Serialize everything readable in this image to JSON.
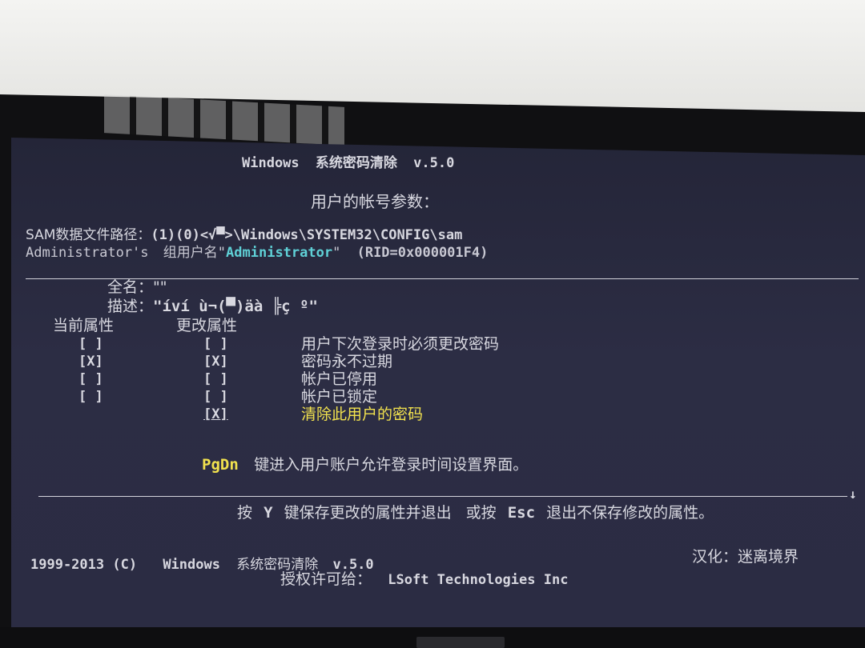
{
  "title_line": {
    "app": "Windows",
    "name": "系统密码清除",
    "version": "v.5.0"
  },
  "subtitle": "用户的帐号参数：",
  "sam_path": {
    "label": "SAM数据文件路径：",
    "value": "(1)(0)<√▀>\\Windows\\SYSTEM32\\CONFIG\\sam"
  },
  "account": {
    "prefix": "Administrator's",
    "group_label": "组用户名",
    "quote_open": "\"",
    "username": "Administrator",
    "quote_close": "\"",
    "rid": "(RID=0x000001F4)"
  },
  "fields": {
    "fullname_label": "全名：",
    "fullname_value": "\"\"",
    "desc_label": "描述：",
    "desc_value": "\"íví ù¬(▀)äà ╠ç º\""
  },
  "columns": {
    "current": "当前属性",
    "change": "更改属性"
  },
  "attributes": [
    {
      "current": "[ ]",
      "change": "[ ]",
      "label": "用户下次登录时必须更改密码",
      "highlight": false
    },
    {
      "current": "[X]",
      "change": "[X]",
      "label": "密码永不过期",
      "highlight": false
    },
    {
      "current": "[ ]",
      "change": "[ ]",
      "label": "帐户已停用",
      "highlight": false
    },
    {
      "current": "[ ]",
      "change": "[ ]",
      "label": "帐户已锁定",
      "highlight": false
    },
    {
      "current": "",
      "change": "[X]",
      "label": "清除此用户的密码",
      "highlight": true
    }
  ],
  "pgdn_hint": {
    "key": "PgDn",
    "text": "键进入用户账户允许登录时间设置界面。"
  },
  "scroll_arrow": "↓",
  "save_hint": {
    "press": "按",
    "key_y": "Y",
    "save_text": "键保存更改的属性并退出",
    "or_press": "或按",
    "key_esc": "Esc",
    "exit_text": "退出不保存修改的属性。"
  },
  "footer": {
    "copyright": "1999-2013 (C)",
    "app": "Windows",
    "name": "系统密码清除",
    "version": "v.5.0",
    "localization_label": "汉化：",
    "localization_value": "迷离境界",
    "license_label": "授权许可给：",
    "license_value": "LSoft Technologies Inc"
  },
  "colors": {
    "screen_bg": "#2a2b41",
    "text": "#d8d8e0",
    "username": "#5fd0d6",
    "highlight": "#f2e24e"
  }
}
